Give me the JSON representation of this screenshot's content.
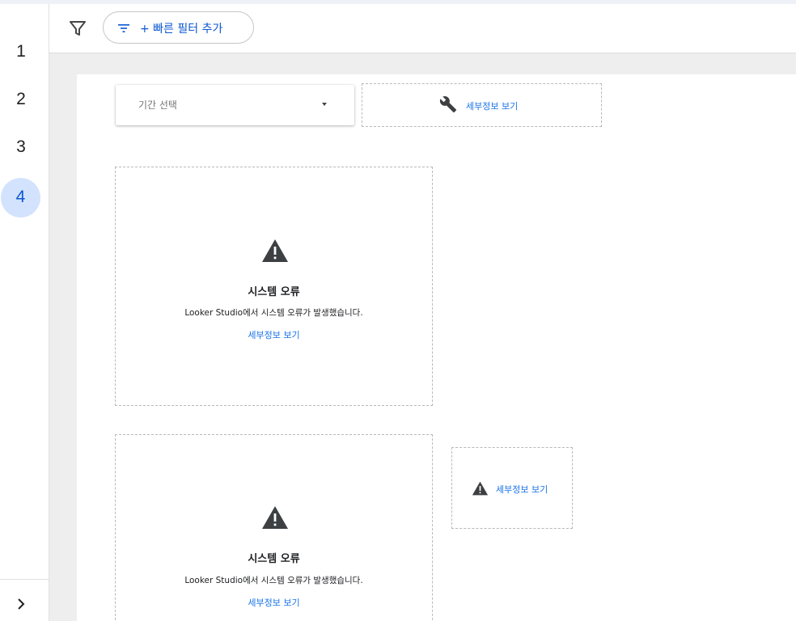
{
  "rail": {
    "pages": [
      "1",
      "2",
      "3",
      "4"
    ],
    "active_page": "4",
    "toggle_icon": "chevron-right-icon"
  },
  "filter_bar": {
    "filter_icon": "filter-icon",
    "quick_filter_icon": "filter-list-icon",
    "quick_filter_label": "+ 빠른 필터 추가"
  },
  "date_control": {
    "placeholder": "기간 선택",
    "icon": "dropdown-caret-icon"
  },
  "top_details": {
    "icon": "wrench-icon",
    "link": "세부정보 보기"
  },
  "error_cards": [
    {
      "icon": "warning-icon",
      "title": "시스템 오류",
      "message": "Looker Studio에서 시스템 오류가 발생했습니다.",
      "link": "세부정보 보기"
    },
    {
      "icon": "warning-icon",
      "title": "시스템 오류",
      "message": "Looker Studio에서 시스템 오류가 발생했습니다.",
      "link": "세부정보 보기"
    }
  ],
  "small_details": {
    "icon": "warning-icon",
    "link": "세부정보 보기"
  },
  "colors": {
    "accent": "#1a73e8",
    "active_page_bg": "#d3e3fd",
    "canvas_bg": "#eeeeee",
    "dashed_border": "#b9b9b9",
    "icon_dark": "#5f6368"
  }
}
